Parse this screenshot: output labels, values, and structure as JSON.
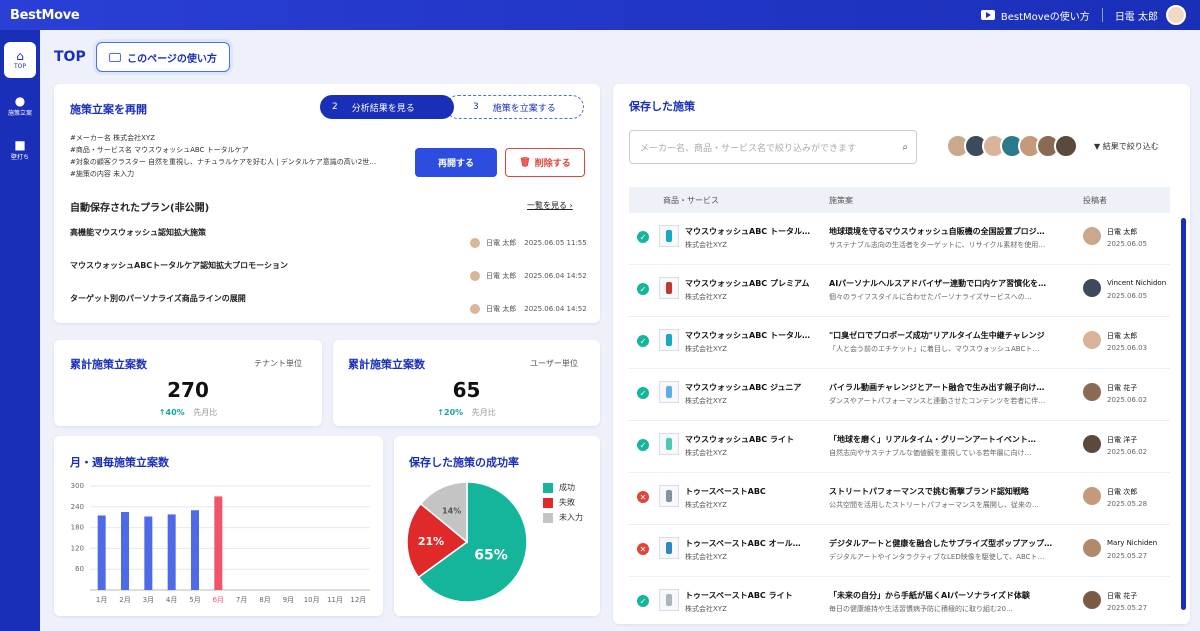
{
  "app": {
    "logo": "BestMove",
    "help_link": "BestMoveの使い方",
    "user_name": "日電 太郎"
  },
  "sidebar": {
    "items": [
      {
        "label": "TOP",
        "icon": "home-icon",
        "active": true
      },
      {
        "label": "施策立案",
        "icon": "lightbulb-icon",
        "active": false
      },
      {
        "label": "壁打ち",
        "icon": "chat-icon",
        "active": false
      }
    ]
  },
  "page": {
    "title": "TOP",
    "howto_button": "このページの使い方"
  },
  "resume": {
    "title": "施策立案を再開",
    "steps": [
      {
        "num": "2",
        "label": "分析結果を見る",
        "active": true
      },
      {
        "num": "3",
        "label": "施策を立案する",
        "active": false
      }
    ],
    "meta": [
      "#メーカー名 株式会社XYZ",
      "#商品・サービス名 マウスウォッシュABC トータルケア",
      "#対象の顧客クラスター 自然を重視し、ナチュラルケアを好む人 | デンタルケア意識の高い2世…",
      "#施策の内容 未入力"
    ],
    "resume_button": "再開する",
    "delete_button": "削除する"
  },
  "autosave": {
    "title": "自動保存されたプラン(非公開)",
    "view_all": "一覧を見る",
    "plans": [
      {
        "title": "高機能マウスウォッシュ認知拡大施策",
        "author": "日電 太郎",
        "date": "2025.06.05 11:55"
      },
      {
        "title": "マウスウォッシュABCトータルケア認知拡大プロモーション",
        "author": "日電 太郎",
        "date": "2025.06.04 14:52"
      },
      {
        "title": "ターゲット別のパーソナライズ商品ラインの展開",
        "author": "日電 太郎",
        "date": "2025.06.04 14:52"
      }
    ]
  },
  "stats": [
    {
      "title": "累計施策立案数",
      "unit": "テナント単位",
      "value": "270",
      "change": "↑40%",
      "change_label": "先月比"
    },
    {
      "title": "累計施策立案数",
      "unit": "ユーザー単位",
      "value": "65",
      "change": "↑20%",
      "change_label": "先月比"
    }
  ],
  "monthly_chart_title": "月・週毎施策立案数",
  "success_chart_title": "保存した施策の成功率",
  "chart_data": [
    {
      "type": "bar",
      "title": "月・週毎施策立案数",
      "categories": [
        "1月",
        "2月",
        "3月",
        "4月",
        "5月",
        "6月",
        "7月",
        "8月",
        "9月",
        "10月",
        "11月",
        "12月"
      ],
      "values": [
        215,
        225,
        212,
        218,
        230,
        270,
        null,
        null,
        null,
        null,
        null,
        null
      ],
      "highlight_index": 5,
      "yticks": [
        60,
        120,
        180,
        240,
        300
      ],
      "ylim": [
        0,
        300
      ],
      "colors": {
        "bar": "#4f6ae6",
        "highlight": "#f0556a"
      }
    },
    {
      "type": "pie",
      "title": "保存した施策の成功率",
      "labels": [
        "成功",
        "失敗",
        "未入力"
      ],
      "values": [
        65,
        21,
        14
      ],
      "display": [
        "65%",
        "21%",
        "14%"
      ],
      "colors": [
        "#14b59b",
        "#e02a2a",
        "#c4c4c4"
      ]
    }
  ],
  "saved": {
    "title": "保存した施策",
    "search_placeholder": "メーカー名、商品・サービス名で絞り込みができます",
    "filter_label": "結果で絞り込む",
    "columns": [
      "商品・サービス",
      "施策案",
      "投稿者"
    ],
    "rows": [
      {
        "status": "success",
        "product": "マウスウォッシュABC トータル…",
        "company": "株式会社XYZ",
        "policy": "地球環境を守るマウスウォッシュ自販機の全国設置プロジ…",
        "desc": "サステナブル志向の生活者をターゲットに、リサイクル素材を使用…",
        "author": "日電 太郎",
        "date": "2025.06.05",
        "color": "#1aa7c4"
      },
      {
        "status": "success",
        "product": "マウスウォッシュABC プレミアム",
        "company": "株式会社XYZ",
        "policy": "AIパーソナルヘルスアドバイザー連動で口内ケア習慣化を…",
        "desc": "個々のライフスタイルに合わせたパーソナライズサービスへの…",
        "author": "Vincent Nichidon",
        "date": "2025.06.05",
        "color": "#c0392b"
      },
      {
        "status": "success",
        "product": "マウスウォッシュABC トータル…",
        "company": "株式会社XYZ",
        "policy": "\"口臭ゼロでプロポーズ成功\"リアルタイム生中継チャレンジ",
        "desc": "「人と会う前のエチケット」に着目し、マウスウォッシュABCト…",
        "author": "日電 太郎",
        "date": "2025.06.03",
        "color": "#1aa7c4"
      },
      {
        "status": "success",
        "product": "マウスウォッシュABC ジュニア",
        "company": "株式会社XYZ",
        "policy": "バイラル動画チャレンジとアート融合で生み出す親子向け…",
        "desc": "ダンスやアートパフォーマンスと連動させたコンテンツを若者に伴…",
        "author": "日電 花子",
        "date": "2025.06.02",
        "color": "#5dade2"
      },
      {
        "status": "success",
        "product": "マウスウォッシュABC ライト",
        "company": "株式会社XYZ",
        "policy": "「地球を磨く」リアルタイム・グリーンアートイベント…",
        "desc": "自然志向やサステナブルな価値観を重視している若年層に向け…",
        "author": "日電 洋子",
        "date": "2025.06.02",
        "color": "#48c9b0"
      },
      {
        "status": "fail",
        "product": "トゥースペーストABC",
        "company": "株式会社XYZ",
        "policy": "ストリートパフォーマンスで挑む衝撃ブランド認知戦略",
        "desc": "公共空間を活用したストリートパフォーマンスを展開し、従来の…",
        "author": "日電 次郎",
        "date": "2025.05.28",
        "color": "#85929e"
      },
      {
        "status": "fail",
        "product": "トゥースペーストABC オール…",
        "company": "株式会社XYZ",
        "policy": "デジタルアートと健康を融合したサプライズ型ポップアップ…",
        "desc": "デジタルアートやインタラクティブなLED映像を駆使して、ABCト…",
        "author": "Mary Nichiden",
        "date": "2025.05.27",
        "color": "#2e86c1"
      },
      {
        "status": "success",
        "product": "トゥースペーストABC ライト",
        "company": "株式会社XYZ",
        "policy": "「未来の自分」から手紙が届くAIパーソナライズド体験",
        "desc": "毎日の健康維持や生活習慣病予防に積極的に取り組む20…",
        "author": "日電 花子",
        "date": "2025.05.27",
        "color": "#aab7b8"
      }
    ]
  }
}
